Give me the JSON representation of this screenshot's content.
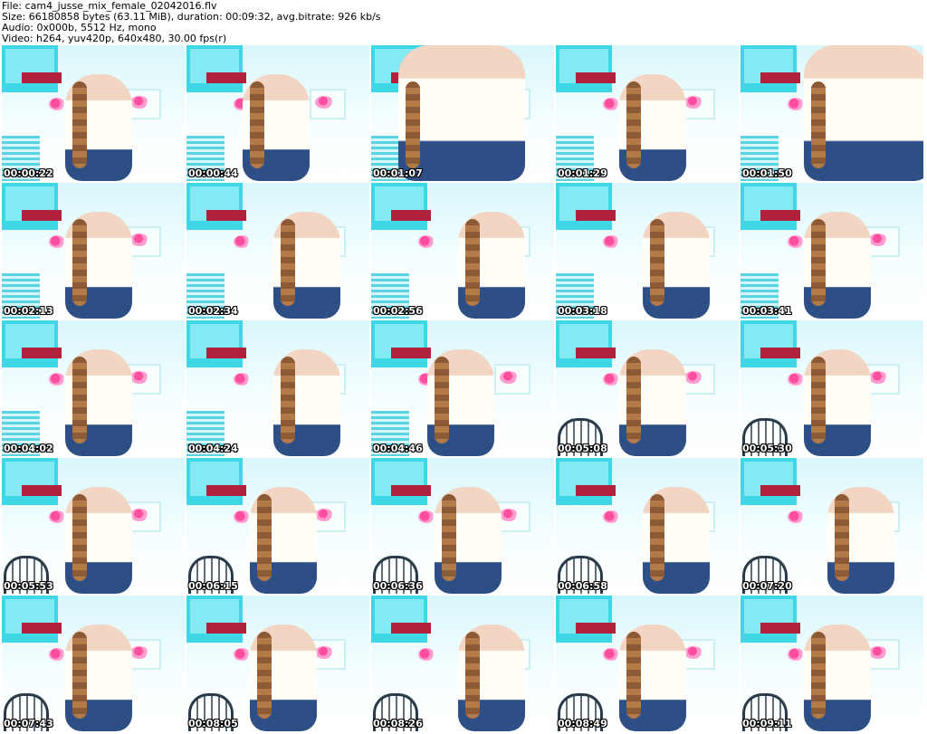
{
  "header": {
    "file_line": "File: cam4_jusse_mix_female_02042016.flv",
    "size_line": "Size: 66180858 bytes (63.11 MiB), duration: 00:09:32, avg.bitrate: 926 kb/s",
    "audio_line": "Audio: 0x000b, 5512 Hz, mono",
    "video_line": "Video: h264, yuv420p, 640x480, 30.00 fps(r)"
  },
  "colors": {
    "background": "#ffffff",
    "text": "#000000",
    "timestamp_text": "#ffffff",
    "timestamp_outline": "#000000",
    "wall_cyan": "#3fd6e6",
    "accent_red": "#b2213b",
    "flower_pink": "#ff4da0",
    "jeans_blue": "#2e4f86"
  },
  "thumbnails": [
    {
      "timestamp": "00:00:22",
      "scene": "standing-front"
    },
    {
      "timestamp": "00:00:44",
      "scene": "back-turned"
    },
    {
      "timestamp": "00:01:07",
      "scene": "closeup-torso"
    },
    {
      "timestamp": "00:01:29",
      "scene": "seated-smile"
    },
    {
      "timestamp": "00:01:50",
      "scene": "seated-closeup"
    },
    {
      "timestamp": "00:02:13",
      "scene": "leaning-smile"
    },
    {
      "timestamp": "00:02:34",
      "scene": "leaning-right"
    },
    {
      "timestamp": "00:02:56",
      "scene": "leaning-right"
    },
    {
      "timestamp": "00:03:18",
      "scene": "leaning-right"
    },
    {
      "timestamp": "00:03:41",
      "scene": "leaning-smile"
    },
    {
      "timestamp": "00:04:02",
      "scene": "leaning-smile"
    },
    {
      "timestamp": "00:04:24",
      "scene": "leaning-right"
    },
    {
      "timestamp": "00:04:46",
      "scene": "back-turned"
    },
    {
      "timestamp": "00:05:08",
      "scene": "seated-front"
    },
    {
      "timestamp": "00:05:30",
      "scene": "seated-front"
    },
    {
      "timestamp": "00:05:53",
      "scene": "seated-front"
    },
    {
      "timestamp": "00:06:15",
      "scene": "seated-front"
    },
    {
      "timestamp": "00:06:36",
      "scene": "seated-front"
    },
    {
      "timestamp": "00:06:58",
      "scene": "leaning-right"
    },
    {
      "timestamp": "00:07:20",
      "scene": "leaning-right"
    },
    {
      "timestamp": "00:07:43",
      "scene": "seated-front"
    },
    {
      "timestamp": "00:08:05",
      "scene": "seated-front"
    },
    {
      "timestamp": "00:08:26",
      "scene": "leaning-right"
    },
    {
      "timestamp": "00:08:49",
      "scene": "seated-front"
    },
    {
      "timestamp": "00:09:11",
      "scene": "seated-front"
    }
  ]
}
